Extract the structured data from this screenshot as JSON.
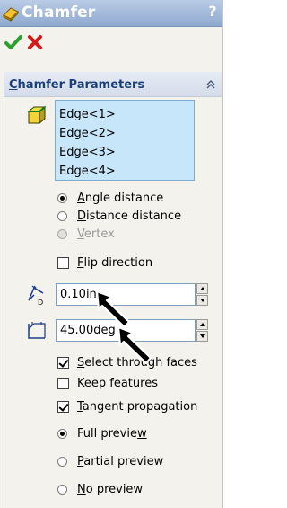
{
  "title": "Chamfer",
  "help_label": "?",
  "group": {
    "title_prefix": "C",
    "title_rest": "hamfer Parameters"
  },
  "edges": [
    "Edge<1>",
    "Edge<2>",
    "Edge<3>",
    "Edge<4>"
  ],
  "chamfer_type": {
    "angle_distance": {
      "u": "A",
      "rest": "ngle distance",
      "selected": true
    },
    "distance_distance": {
      "u": "D",
      "rest": "istance distance",
      "selected": false
    },
    "vertex": {
      "u": "V",
      "rest": "ertex",
      "selected": false,
      "disabled": true
    }
  },
  "flip_direction": {
    "u": "F",
    "rest": "lip direction",
    "checked": false
  },
  "distance_value": "0.10in",
  "angle_value": "45.00deg",
  "select_through_faces": {
    "u": "S",
    "rest": "elect through faces",
    "checked": true
  },
  "keep_features": {
    "u": "K",
    "rest": "eep features",
    "checked": false
  },
  "tangent_propagation": {
    "u": "T",
    "rest": "angent propagation",
    "checked": true
  },
  "preview": {
    "full": {
      "pre": "Full previe",
      "u": "w",
      "selected": true
    },
    "partial": {
      "u": "P",
      "rest": "artial preview",
      "selected": false
    },
    "none": {
      "u": "N",
      "rest": "o preview",
      "selected": false
    }
  },
  "colors": {
    "title_bar": "#8fa9cf",
    "group_title": "#1c3f7a",
    "selection_box": "#c8e6fa",
    "ok_green": "#2e9e2e",
    "cancel_red": "#d21a1a"
  },
  "icons": [
    "chamfer-icon",
    "help-icon",
    "ok-check-icon",
    "cancel-x-icon",
    "collapse-chevrons-icon",
    "edge-selection-icon",
    "distance-icon",
    "angle-icon",
    "cursor-arrow-icon"
  ]
}
